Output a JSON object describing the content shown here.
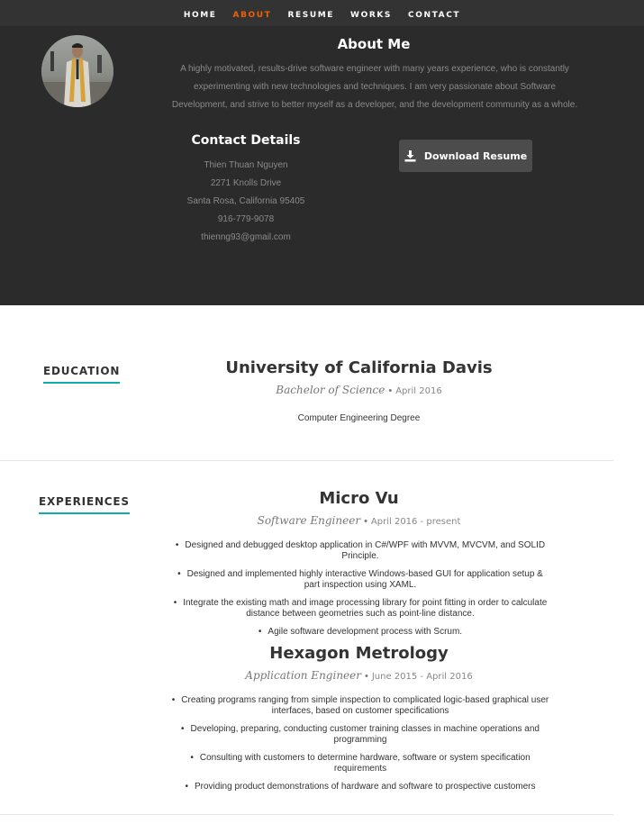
{
  "nav": {
    "items": [
      {
        "label": "HOME",
        "active": false
      },
      {
        "label": "ABOUT",
        "active": true
      },
      {
        "label": "RESUME",
        "active": false
      },
      {
        "label": "WORKS",
        "active": false
      },
      {
        "label": "CONTACT",
        "active": false
      }
    ]
  },
  "about": {
    "title": "About Me",
    "bio_lines": [
      "A highly motivated, results-drive software engineer with many years experience, who is constantly",
      "experimenting with new technologies and techniques. I am very passionate about Software",
      "Development, and strive to better myself as a developer, and the development community as a whole."
    ],
    "contact_title": "Contact Details",
    "contact": {
      "name": "Thien Thuan Nguyen",
      "street": "2271 Knolls Drive",
      "city": "Santa Rosa, California 95405",
      "phone": "916-779-9078",
      "email": "thienng93@gmail.com"
    },
    "download_label": "Download Resume",
    "download_icon": "download-icon"
  },
  "education": {
    "label": "EDUCATION",
    "school": "University of California Davis",
    "degree_short": "Bachelor of Science",
    "date": "April 2016",
    "degree": "Computer Engineering Degree"
  },
  "experiences": {
    "label": "EXPERIENCES",
    "jobs": [
      {
        "company": "Micro Vu",
        "role": "Software Engineer",
        "dates": "April 2016 - present",
        "bullets": [
          [
            "Designed and debugged desktop application in C#/WPF with MVVM, MVCVM, and SOLID",
            "Principle."
          ],
          [
            "Designed and implemented highly interactive Windows-based GUI for application setup &",
            "part inspection using XAML."
          ],
          [
            "Integrate the existing math and image processing library for point fitting in order to calculate",
            "distance between geometries such as point-line distance."
          ],
          [
            "Agile software development process with Scrum."
          ]
        ]
      },
      {
        "company": "Hexagon Metrology",
        "role": "Application Engineer",
        "dates": "June 2015 - April 2016",
        "bullets": [
          [
            "Creating programs ranging from simple inspection to complicated logic-based graphical user",
            "interfaces, based on customer specifications"
          ],
          [
            "Developing, preparing, conducting customer training classes in machine operations and",
            "programming"
          ],
          [
            "Consulting with customers to determine hardware, software or system specification",
            "requirements"
          ],
          [
            "Providing product demonstrations of hardware and software to prospective customers"
          ]
        ]
      }
    ]
  },
  "colors": {
    "nav_bg": "#333333",
    "about_bg": "#2b2b2b",
    "accent": "#f06000",
    "underline": "#11abb0",
    "button_bg": "#4c4c4c"
  }
}
